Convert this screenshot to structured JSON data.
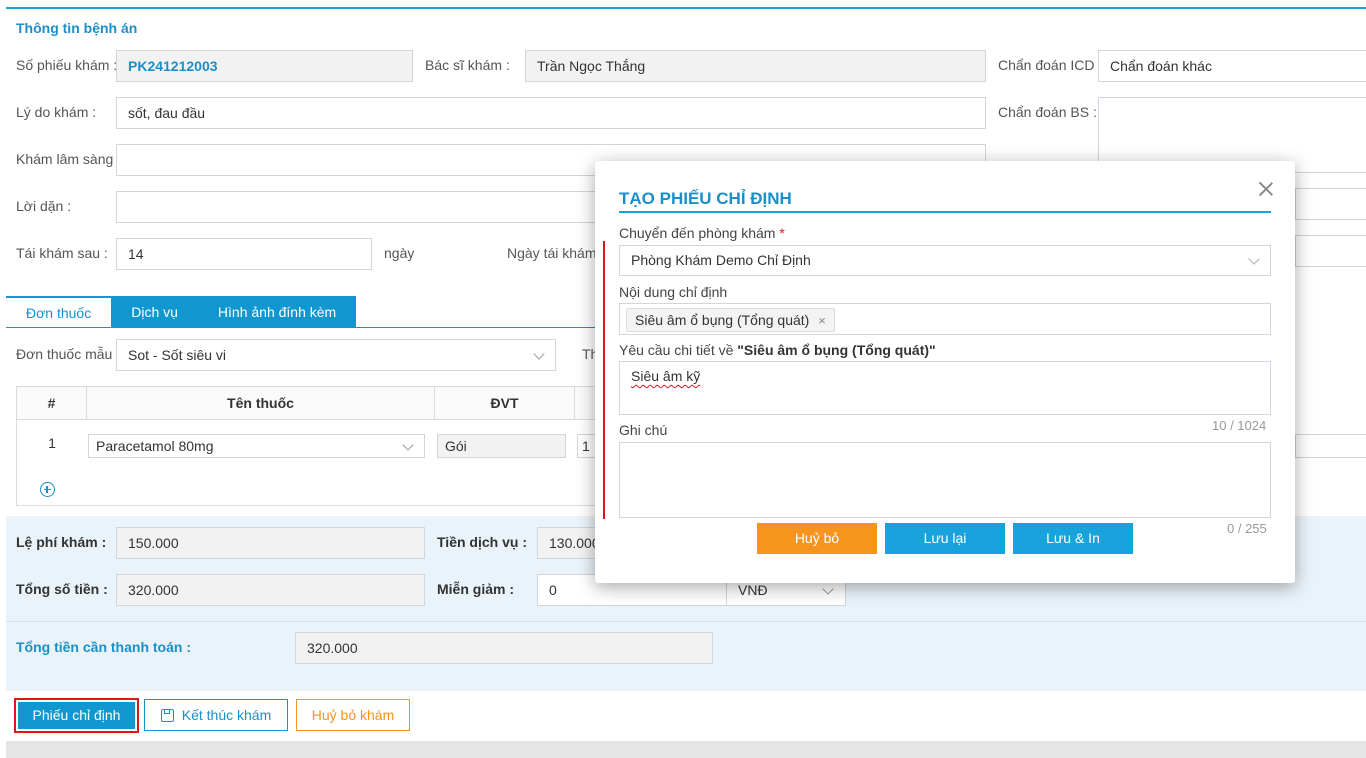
{
  "section_title": "Thông tin bệnh án",
  "form": {
    "so_phieu_label": "Số phiếu khám :",
    "so_phieu_value": "PK241212003",
    "bac_si_label": "Bác sĩ khám :",
    "bac_si_value": "Trần Ngọc Thắng",
    "chan_doan_icd_label": "Chẩn đoán ICD :",
    "chan_doan_icd_value": "Chẩn đoán khác",
    "ly_do_label": "Lý do khám :",
    "ly_do_value": "sốt, đau đầu",
    "chan_doan_bs_label": "Chẩn đoán BS :",
    "kham_ls_label": "Khám lâm sàng :",
    "loi_dan_label": "Lời dặn :",
    "tai_kham_label": "Tái khám sau :",
    "tai_kham_value": "14",
    "ngay_label": "ngày",
    "ngay_tai_kham_label": "Ngày tái khám"
  },
  "tabs": [
    "Đơn thuốc",
    "Dịch vụ",
    "Hình ảnh đính kèm"
  ],
  "prescription": {
    "template_label": "Đơn thuốc mẫu :",
    "template_value": "Sot - Sốt siêu vi",
    "partial_label": "Th",
    "columns": [
      "#",
      "Tên thuốc",
      "ĐVT"
    ],
    "rows": [
      {
        "no": "1",
        "name": "Paracetamol 80mg",
        "unit": "Gói",
        "qty": "1"
      }
    ]
  },
  "fees": {
    "le_phi_label": "Lệ phí khám :",
    "le_phi_value": "150.000",
    "tien_dv_label": "Tiền dịch vụ :",
    "tien_dv_value": "130.000",
    "tong_label": "Tổng số tiền :",
    "tong_value": "320.000",
    "mien_giam_label": "Miễn giảm :",
    "mien_giam_value": "0",
    "currency": "VNĐ",
    "can_tt_label": "Tổng tiền cần thanh toán :",
    "can_tt_value": "320.000"
  },
  "actions": {
    "phieu_chi_dinh": "Phiếu chỉ định",
    "ket_thuc": "Kết thúc khám",
    "huy_bo_kham": "Huỷ bỏ khám"
  },
  "modal": {
    "title": "TẠO PHIẾU CHỈ ĐỊNH",
    "room_label": "Chuyển đến phòng khám",
    "required_mark": "*",
    "room_value": "Phòng Khám Demo Chỉ Định",
    "content_label": "Nội dung chỉ định",
    "content_tag": "Siêu âm ổ bụng (Tổng quát)",
    "detail_label_prefix": "Yêu cầu chi tiết về",
    "detail_label_target": "\"Siêu âm ổ bụng (Tổng quát)\"",
    "detail_value": "Siêu âm kỹ",
    "detail_counter": "10 / 1024",
    "note_label": "Ghi chú",
    "note_value": "",
    "note_counter": "0 / 255",
    "cancel_label": "Huỷ bỏ",
    "save_label": "Lưu lại",
    "save_print_label": "Lưu & In"
  },
  "colors": {
    "accent": "#1197cf",
    "orange": "#f7941d",
    "highlight_red": "#e0141e"
  }
}
